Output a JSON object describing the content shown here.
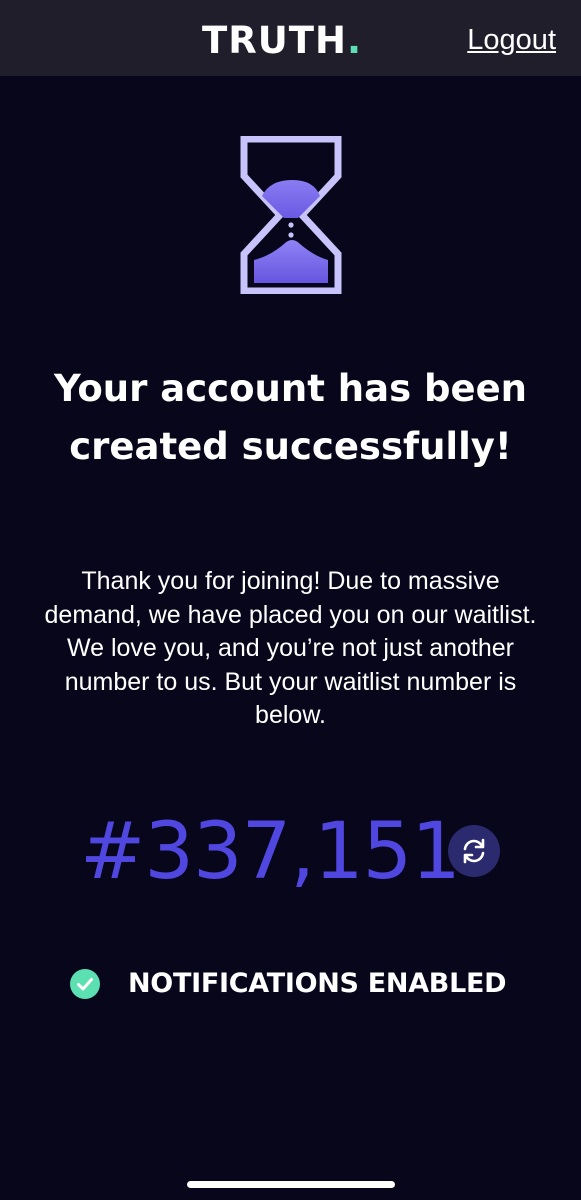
{
  "header": {
    "logo_text": "TRUTH",
    "logo_dot": ".",
    "logout_label": "Logout"
  },
  "main": {
    "icon": "hourglass-icon",
    "title": "Your account has been created successfully!",
    "message": "Thank you for joining! Due to massive demand, we have placed you on our waitlist. We love you, and you’re not just another number to us. But your waitlist number is below.",
    "waitlist_number": "#337,151",
    "refresh_icon": "refresh-icon"
  },
  "notifications": {
    "icon": "check-circle-icon",
    "label": "NOTIFICATIONS ENABLED"
  },
  "colors": {
    "background": "#07061a",
    "header_background": "#1f1e2a",
    "accent": "#5046e0",
    "logo_dot": "#5ce0b2",
    "check": "#5ce0b2",
    "hourglass_light": "#c9c3fb",
    "hourglass_fill": "#6c5ce7"
  }
}
